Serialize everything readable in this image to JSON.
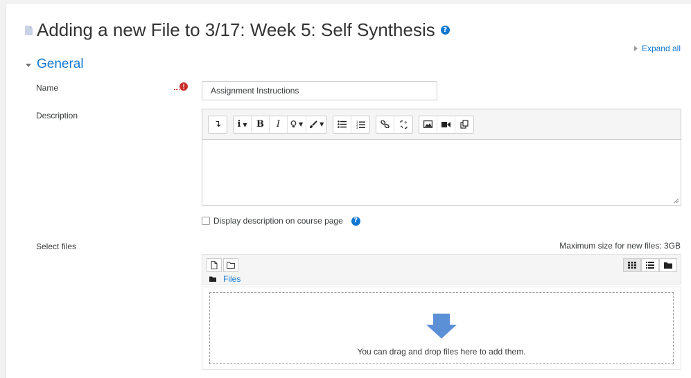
{
  "header": {
    "title": "Adding a new File to 3/17: Week 5: Self Synthesis",
    "expand_all": "Expand all"
  },
  "section": {
    "title": "General"
  },
  "form": {
    "name_label": "Name",
    "name_value": "Assignment Instructions",
    "description_label": "Description",
    "display_description_label": "Display description on course page",
    "select_files_label": "Select files",
    "max_size": "Maximum size for new files: 3GB"
  },
  "editor": {
    "toolbar": [
      "collapse",
      "info",
      "bold",
      "italic",
      "style",
      "paint",
      "unordered-list",
      "ordered-list",
      "link",
      "unlink",
      "image",
      "video",
      "manage-files"
    ]
  },
  "filepicker": {
    "path_label": "Files",
    "drop_text": "You can drag and drop files here to add them."
  },
  "colors": {
    "link": "#1177d1",
    "required": "#c9302c",
    "arrow": "#5b8fd6"
  }
}
